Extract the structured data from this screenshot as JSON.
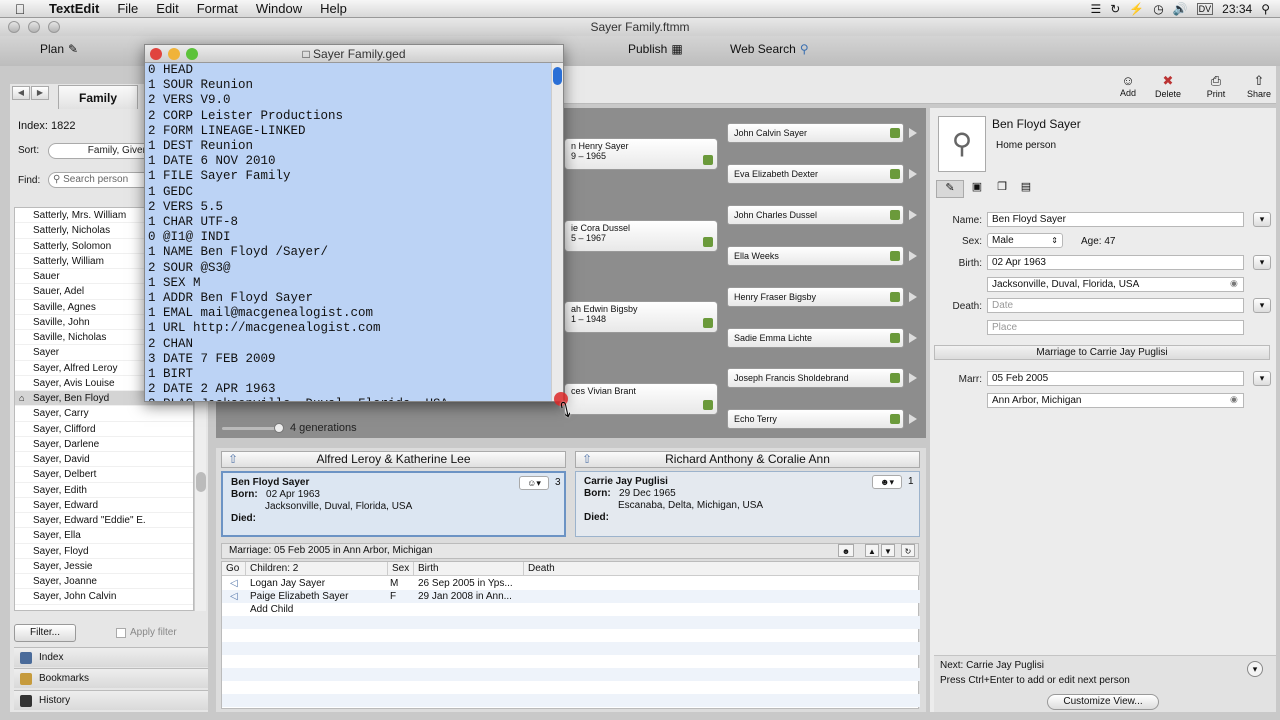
{
  "menubar": {
    "app": "TextEdit",
    "menus": [
      "File",
      "Edit",
      "Format",
      "Window",
      "Help"
    ],
    "time": "23:34",
    "dv": "DV"
  },
  "window": {
    "title": "Sayer Family.ftmm"
  },
  "toolbar": {
    "plan": "Plan",
    "publish": "Publish",
    "web_search": "Web Search",
    "add": "Add",
    "delete": "Delete",
    "print": "Print",
    "share": "Share"
  },
  "left": {
    "tab": "Family",
    "index_label": "Index: 1822",
    "sort_label": "Sort:",
    "sort_value": "Family, Given N",
    "find_label": "Find:",
    "search_placeholder": "Search person",
    "persons": [
      "Satterly, Mrs. William",
      "Satterly, Nicholas",
      "Satterly, Solomon",
      "Satterly, William",
      "Sauer",
      "Sauer, Adel",
      "Saville, Agnes",
      "Saville, John",
      "Saville, Nicholas",
      "Sayer",
      "Sayer, Alfred Leroy",
      "Sayer, Avis Louise",
      "Sayer, Ben Floyd",
      "Sayer, Carry",
      "Sayer, Clifford",
      "Sayer, Darlene",
      "Sayer, David",
      "Sayer, Delbert",
      "Sayer, Edith",
      "Sayer, Edward",
      "Sayer, Edward \"Eddie\" E.",
      "Sayer, Ella",
      "Sayer, Floyd",
      "Sayer, Jessie",
      "Sayer, Joanne",
      "Sayer, John Calvin"
    ],
    "selected_index": 12,
    "filter_button": "Filter...",
    "apply_filter": "Apply filter",
    "nav": [
      "Index",
      "Bookmarks",
      "History"
    ]
  },
  "tree": {
    "parents": [
      {
        "name": "n Henry Sayer",
        "dates": "9 – 1965"
      },
      {
        "name": "ie Cora Dussel",
        "dates": "5 – 1967"
      },
      {
        "name": "ah Edwin Bigsby",
        "dates": "1 – 1948"
      },
      {
        "name": "ces Vivian Brant",
        "dates": ""
      }
    ],
    "grandparents": [
      "John Calvin Sayer",
      "Eva Elizabeth Dexter",
      "John Charles Dussel",
      "Ella Weeks",
      "Henry Fraser Bigsby",
      "Sadie Emma Lichte",
      "Joseph Francis Sholdebrand",
      "Echo Terry"
    ],
    "generations": "4 generations"
  },
  "ged": {
    "title": "Sayer Family.ged",
    "lines": [
      "0 HEAD",
      "1 SOUR Reunion",
      "2 VERS V9.0",
      "2 CORP Leister Productions",
      "2 FORM LINEAGE-LINKED",
      "1 DEST Reunion",
      "1 DATE 6 NOV 2010",
      "1 FILE Sayer Family",
      "1 GEDC",
      "2 VERS 5.5",
      "1 CHAR UTF-8",
      "0 @I1@ INDI",
      "1 NAME Ben Floyd /Sayer/",
      "2 SOUR @S3@",
      "1 SEX M",
      "1 ADDR Ben Floyd Sayer",
      "1 EMAL mail@macgenealogist.com",
      "1 URL http://macgenealogist.com",
      "2 CHAN",
      "3 DATE 7 FEB 2009",
      "1 BIRT",
      "2 DATE 2 APR 1963",
      "2 PLAC Jacksonville, Duval, Florida, USA"
    ]
  },
  "person": {
    "name": "Ben Floyd Sayer",
    "subtitle": "Home person",
    "name_label": "Name:",
    "name_value": "Ben Floyd Sayer",
    "sex_label": "Sex:",
    "sex_value": "Male",
    "age": "Age: 47",
    "birth_label": "Birth:",
    "birth_date": "02 Apr 1963",
    "birth_place": "Jacksonville, Duval, Florida, USA",
    "death_label": "Death:",
    "death_date_placeholder": "Date",
    "death_place_placeholder": "Place",
    "marriage_header": "Marriage to Carrie Jay Puglisi",
    "marr_label": "Marr:",
    "marr_date": "05 Feb 2005",
    "marr_place": "Ann Arbor, Michigan",
    "next_label": "Next:  Carrie Jay Puglisi",
    "next_hint": "Press Ctrl+Enter to add or edit next person",
    "customize": "Customize View..."
  },
  "family": {
    "left_parents": "Alfred Leroy & Katherine Lee",
    "right_parents": "Richard Anthony & Coralie Ann",
    "husband": {
      "name": "Ben Floyd Sayer",
      "born_label": "Born:",
      "born_date": "02 Apr 1963",
      "born_place": "Jacksonville, Duval, Florida, USA",
      "died_label": "Died:",
      "count": "3"
    },
    "wife": {
      "name": "Carrie Jay Puglisi",
      "born_label": "Born:",
      "born_date": "29 Dec 1965",
      "born_place": "Escanaba, Delta, Michigan, USA",
      "died_label": "Died:",
      "count": "1"
    },
    "marriage": "Marriage: 05 Feb 2005 in Ann Arbor, Michigan",
    "columns": [
      "Go",
      "Children: 2",
      "Sex",
      "Birth",
      "Death"
    ],
    "children": [
      {
        "name": "Logan Jay Sayer",
        "sex": "M",
        "birth": "26 Sep 2005 in Yps..."
      },
      {
        "name": "Paige Elizabeth Sayer",
        "sex": "F",
        "birth": "29 Jan 2008 in Ann..."
      }
    ],
    "add_child": "Add Child"
  },
  "colors": {
    "selection": "#bcd3f5",
    "tree_bg": "#8d8d8d",
    "leaf": "#6b9a3b",
    "card_selected": "#dce6f2"
  }
}
